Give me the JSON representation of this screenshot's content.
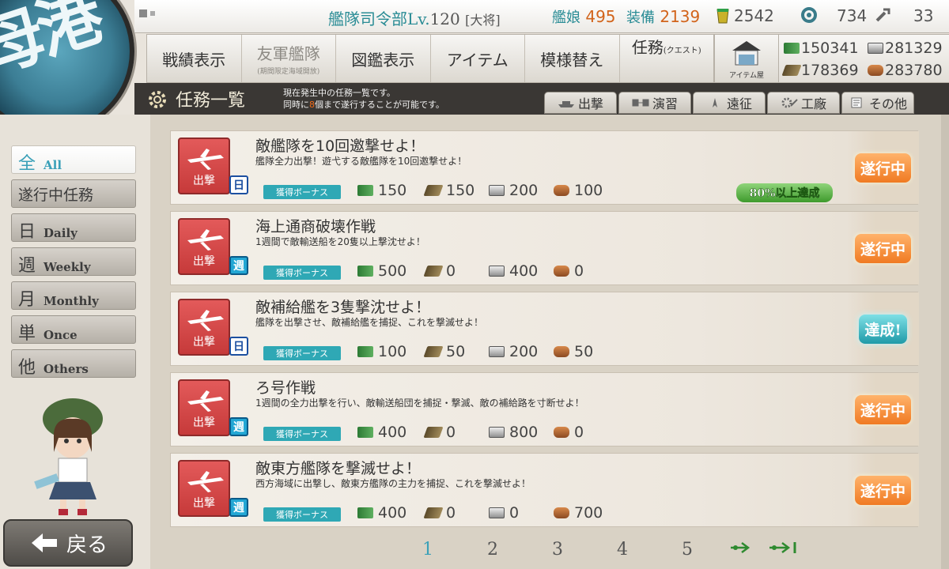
{
  "logo_text": "母港",
  "status": {
    "hq_label": "艦隊司令部Lv.",
    "hq_level": "120",
    "rank": "[大将]",
    "ships_label": "艦娘",
    "ships": "495",
    "equip_label": "装備",
    "equip": "2139",
    "bucket": "2542",
    "devmat": "734",
    "screws": "33"
  },
  "nav": {
    "items": [
      {
        "label": "戦績表示"
      },
      {
        "label": "友軍艦隊",
        "sub": "(期間限定海域開放)"
      },
      {
        "label": "図鑑表示"
      },
      {
        "label": "アイテム"
      },
      {
        "label": "模様替え"
      },
      {
        "label": "任務",
        "small": "(クエスト)"
      }
    ],
    "shop_label": "アイテム屋"
  },
  "resources": {
    "fuel": "150341",
    "steel": "281329",
    "ammo": "178369",
    "bauxite": "283780"
  },
  "header": {
    "title": "任務一覧",
    "desc_line1": "現在発生中の任務一覧です。",
    "desc_line2_pre": "同時に",
    "desc_line2_num": "8",
    "desc_line2_post": "個まで遂行することが可能です。"
  },
  "category_tabs": [
    "出撃",
    "演習",
    "遠征",
    "工廠",
    "その他"
  ],
  "sidebar": {
    "tabs": [
      {
        "kanji": "全",
        "en": "All"
      },
      {
        "solo": "遂行中任務"
      },
      {
        "kanji": "日",
        "en": "Daily"
      },
      {
        "kanji": "週",
        "en": "Weekly"
      },
      {
        "kanji": "月",
        "en": "Monthly"
      },
      {
        "kanji": "単",
        "en": "Once"
      },
      {
        "kanji": "他",
        "en": "Others"
      }
    ],
    "back_label": "戻る"
  },
  "quests": [
    {
      "badge": "出撃",
      "freq": "日",
      "title": "敵艦隊を10回邀撃せよ！",
      "desc": "艦隊全力出撃！遊弋する敵艦隊を10回邀撃せよ！",
      "bonus": "獲得ボーナス",
      "fuel": "150",
      "ammo": "150",
      "steel": "200",
      "bauxite": "100",
      "progress": "80%以上達成",
      "status": "遂行中"
    },
    {
      "badge": "出撃",
      "freq": "週",
      "title": "海上通商破壊作戦",
      "desc": "1週間で敵輸送船を20隻以上撃沈せよ！",
      "bonus": "獲得ボーナス",
      "fuel": "500",
      "ammo": "0",
      "steel": "400",
      "bauxite": "0",
      "progress": "",
      "status": "遂行中"
    },
    {
      "badge": "出撃",
      "freq": "日",
      "title": "敵補給艦を3隻撃沈せよ！",
      "desc": "艦隊を出撃させ、敵補給艦を捕捉、これを撃滅せよ！",
      "bonus": "獲得ボーナス",
      "fuel": "100",
      "ammo": "50",
      "steel": "200",
      "bauxite": "50",
      "progress": "",
      "status": "達成!"
    },
    {
      "badge": "出撃",
      "freq": "週",
      "title": "ろ号作戦",
      "desc": "1週間の全力出撃を行い、敵輸送船団を捕捉・撃滅、敵の補給路を寸断せよ！",
      "bonus": "獲得ボーナス",
      "fuel": "400",
      "ammo": "0",
      "steel": "800",
      "bauxite": "0",
      "progress": "",
      "status": "遂行中"
    },
    {
      "badge": "出撃",
      "freq": "週",
      "title": "敵東方艦隊を撃滅せよ！",
      "desc": "西方海域に出撃し、敵東方艦隊の主力を捕捉、これを撃滅せよ！",
      "bonus": "獲得ボーナス",
      "fuel": "400",
      "ammo": "0",
      "steel": "0",
      "bauxite": "700",
      "progress": "",
      "status": "遂行中"
    }
  ],
  "pagination": {
    "pages": [
      "1",
      "2",
      "3",
      "4",
      "5"
    ],
    "current": "1",
    "next_icon": "next-arrow-icon",
    "last_icon": "last-arrow-icon"
  },
  "colors": {
    "accent_teal": "#3aa0b8",
    "status_orange": "#f07a22",
    "status_done": "#1f9aa8",
    "badge_red": "#c63a3a"
  }
}
